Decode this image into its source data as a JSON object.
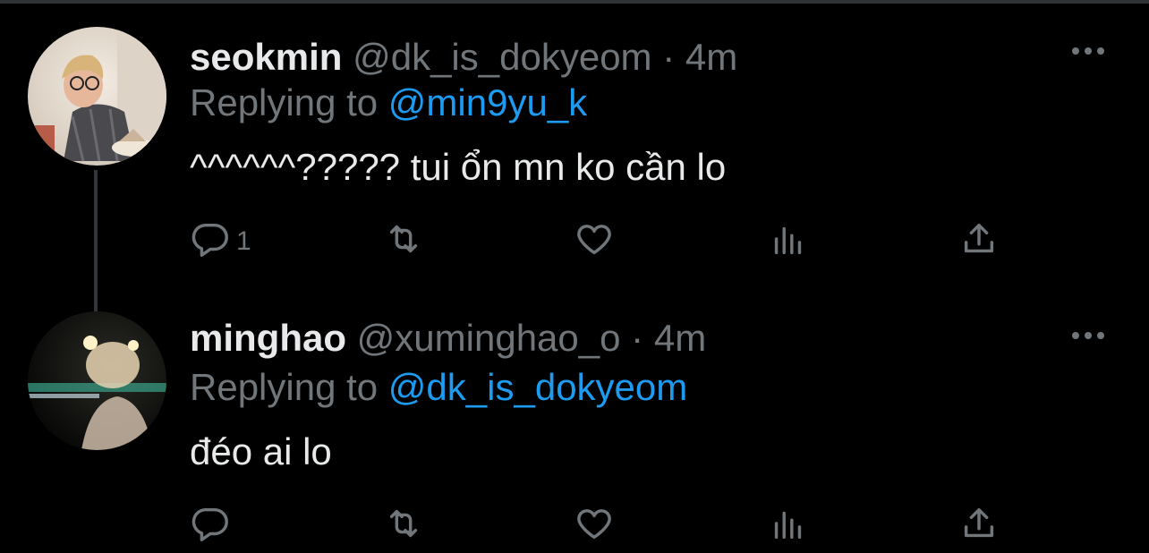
{
  "tweets": [
    {
      "name": "seokmin",
      "handle": "@dk_is_dokyeom",
      "dot": "·",
      "time": "4m",
      "replying_prefix": "Replying to",
      "replying_to": "@min9yu_k",
      "text": "^^^^^^????? tui ổn mn ko cần lo",
      "reply_count": "1"
    },
    {
      "name": "minghao",
      "handle": "@xuminghao_o",
      "dot": "·",
      "time": "4m",
      "replying_prefix": "Replying to",
      "replying_to": "@dk_is_dokyeom",
      "text": "đéo ai lo",
      "reply_count": ""
    }
  ],
  "icons": {
    "reply": "reply-icon",
    "retweet": "retweet-icon",
    "like": "heart-icon",
    "views": "analytics-icon",
    "share": "share-icon",
    "more": "more-options-icon"
  },
  "colors": {
    "background": "#000000",
    "text": "#e7e9ea",
    "muted": "#71767b",
    "mention": "#1d9bf0",
    "thread_line": "#333639"
  }
}
